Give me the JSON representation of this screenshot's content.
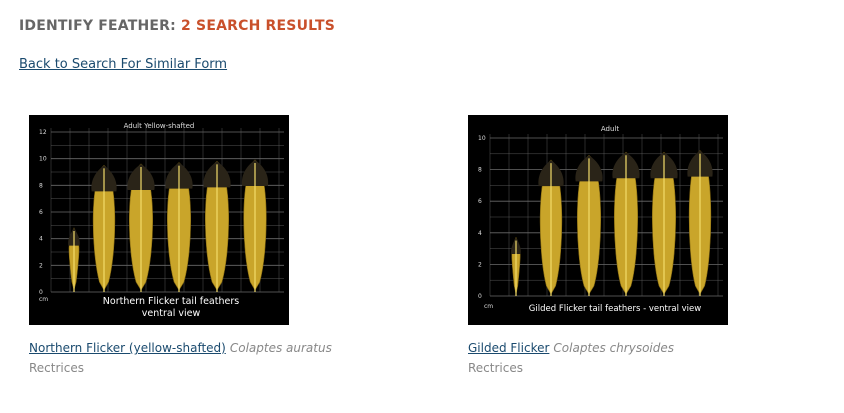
{
  "heading": {
    "label": "IDENTIFY FEATHER:",
    "count": "2 SEARCH RESULTS"
  },
  "back_link": "Back to Search For Similar Form",
  "colors": {
    "accent": "#c9502b",
    "link": "#1a4a6e",
    "muted": "#888888"
  },
  "results": [
    {
      "common_name": "Northern Flicker (yellow-shafted)",
      "scientific_name": "Colaptes auratus",
      "feather_type": "Rectrices",
      "image": {
        "top_label": "Adult Yellow-shafted",
        "caption_line1": "Northern Flicker tail feathers",
        "caption_line2": "ventral view",
        "axis_unit": "cm",
        "y_ticks": [
          "0",
          "2",
          "4",
          "6",
          "8",
          "10",
          "12"
        ],
        "feather_lengths_cm": [
          4.8,
          9.5,
          9.6,
          9.7,
          9.8,
          9.9
        ]
      }
    },
    {
      "common_name": "Gilded Flicker",
      "scientific_name": "Colaptes chrysoides",
      "feather_type": "Rectrices",
      "image": {
        "top_label": "Adult",
        "caption_line1": "Gilded Flicker tail feathers - ventral view",
        "caption_line2": "",
        "axis_unit": "cm",
        "y_ticks": [
          "0",
          "2",
          "4",
          "6",
          "8",
          "10"
        ],
        "feather_lengths_cm": [
          3.7,
          8.6,
          8.9,
          9.1,
          9.1,
          9.2
        ]
      }
    }
  ]
}
